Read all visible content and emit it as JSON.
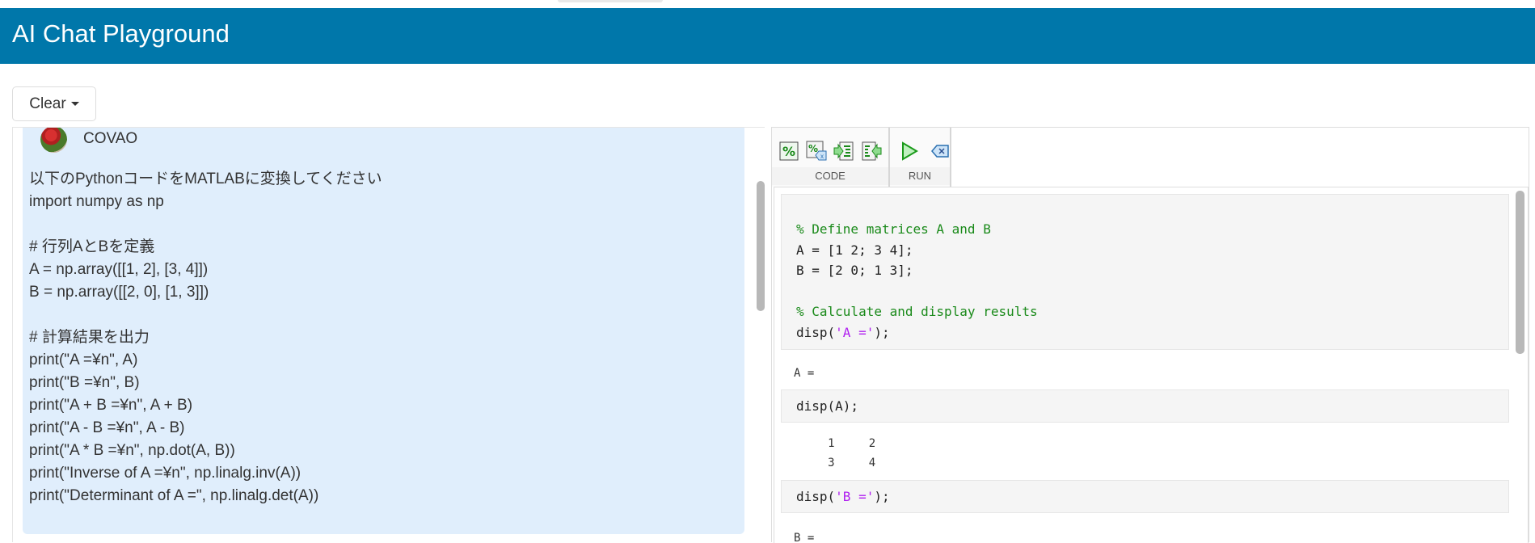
{
  "app": {
    "title": "AI Chat Playground"
  },
  "toolbar": {
    "clear_label": "Clear"
  },
  "chat": {
    "user_name": "COVAO",
    "message_lines": [
      "以下のPythonコードをMATLABに変換してください",
      "import numpy as np",
      "",
      "# 行列AとBを定義",
      "A = np.array([[1, 2], [3, 4]])",
      "B = np.array([[2, 0], [1, 3]])",
      "",
      "# 計算結果を出力",
      "print(\"A =¥n\", A)",
      "print(\"B =¥n\", B)",
      "print(\"A + B =¥n\", A + B)",
      "print(\"A - B =¥n\", A - B)",
      "print(\"A * B =¥n\", np.dot(A, B))",
      "print(\"Inverse of A =¥n\", np.linalg.inv(A))",
      "print(\"Determinant of A =\", np.linalg.det(A))"
    ]
  },
  "ribbon": {
    "code_label": "CODE",
    "run_label": "RUN",
    "code_icons": [
      "comment-icon",
      "uncomment-icon",
      "indent-icon",
      "outdent-icon"
    ],
    "run_icons": [
      "run-icon",
      "clear-output-icon"
    ]
  },
  "live_script": {
    "block1": {
      "comment1": "% Define matrices A and B",
      "line_a": "A = [1 2; 3 4];",
      "line_b": "B = [2 0; 1 3];",
      "comment2": "% Calculate and display results",
      "disp_prefix": "disp(",
      "disp_str": "'A ='",
      "disp_suffix": ");"
    },
    "output1": "A =",
    "block2": "disp(A);",
    "output2": [
      "     1     2",
      "     3     4"
    ],
    "block3": {
      "disp_prefix": "disp(",
      "disp_str": "'B ='",
      "disp_suffix": ");"
    },
    "output3": "B ="
  },
  "colors": {
    "header": "#0077aa",
    "bubble": "#e0eefc",
    "comment": "#1a8a1a",
    "string": "#b020f0"
  }
}
